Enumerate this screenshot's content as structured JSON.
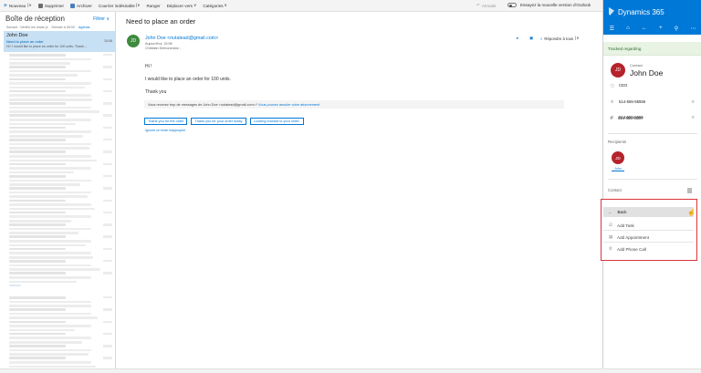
{
  "toolbar": {
    "new_label": "Nouveau",
    "delete_label": "Supprimer",
    "archive_label": "Archiver",
    "junk_label": "Courrier indésirable",
    "sweep_label": "Ranger",
    "move_label": "Déplacer vers",
    "categories_label": "Catégories",
    "undo_label": "Annuler",
    "try_label": "Essayez la nouvelle version d'Outlook"
  },
  "maillist": {
    "title": "Boîte de réception",
    "filter_label": "Filtrer",
    "sub_next": "Suivant : Vérifier les leads (s",
    "sub_time": "Demain à 08:00",
    "sub_agenda": "Agenda",
    "selected": {
      "sender": "John Doe",
      "subject": "Need to place an order",
      "preview": "Hi ! I would like to place an order for 100 units. Thank...",
      "time": "15:08"
    }
  },
  "reading": {
    "subject": "Need to place an order",
    "avatar_initials": "JD",
    "sender": "John Doe <nutalead@gmail.com>",
    "meta_time": "Aujourd'hui, 15:08",
    "meta_to": "Christian Drimorandus ;",
    "reply_all_label": "Répondre à tous",
    "greeting": "Hi !",
    "body_line1": "I would like to place an order for 100 units.",
    "body_line2": "Thank you",
    "notice_text": "Vous recevez trop de messages de John Doe <nutalead@gmail.com>?",
    "notice_link": "Vous pouvez annuler votre abonnement",
    "quick_replies": [
      "Thank you for the order",
      "Thank you for your order today.",
      "Looking forward to your order."
    ],
    "ignore_label": "Ignorer un texte inapproprié"
  },
  "dynamics": {
    "title": "Dynamics 365",
    "tracked_label": "Tracked regarding",
    "contact_role": "Contact",
    "contact_initials": "JD",
    "contact_name": "John Doe",
    "contact_title": "CEO",
    "phone1": "514-555-55555",
    "phone2": "514-555-5555",
    "phone3": "514-555-5500",
    "recipients_label": "Recipients",
    "recipient_initials": "JD",
    "recipient_name": "John",
    "contact_section_label": "Contact"
  },
  "menu": {
    "back_label": "Back",
    "items": [
      "Add Task",
      "Add Appointment",
      "Add Phone Call"
    ]
  },
  "colors": {
    "accent": "#0078d7",
    "contact_avatar": "#b5232b",
    "sender_avatar": "#3e8a3e",
    "highlight_border": "#d9343b"
  }
}
